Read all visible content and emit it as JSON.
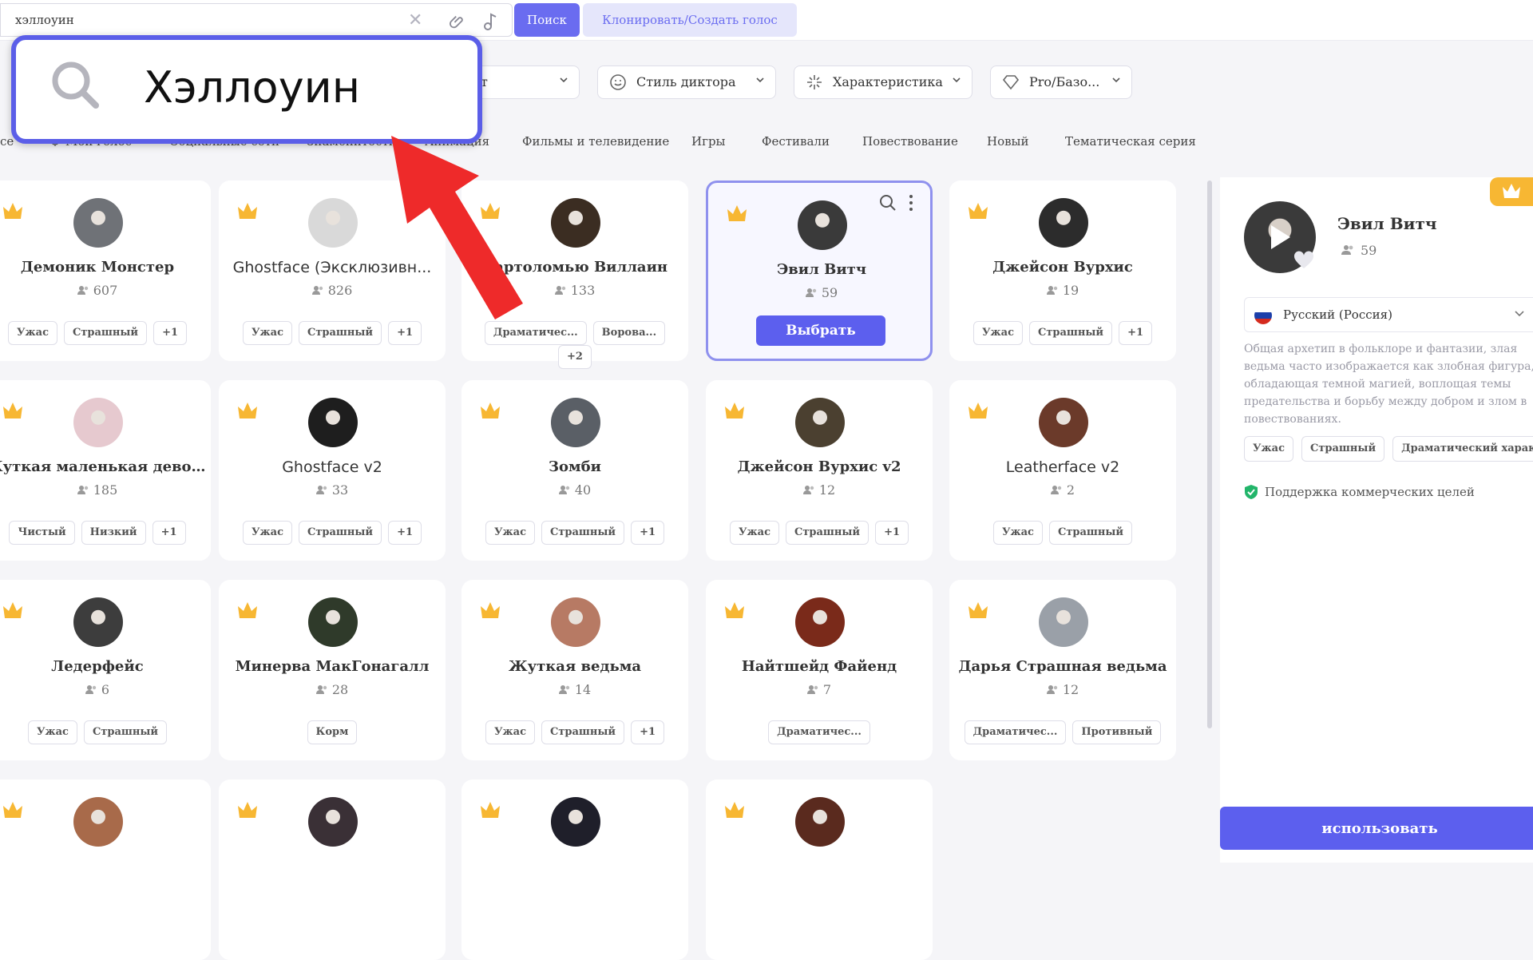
{
  "topbar": {
    "search_value": "хэллоуин",
    "search_button": "Поиск",
    "clone_button": "Клонировать/Создать голос"
  },
  "zoom_overlay": {
    "text": "Хэллоуин"
  },
  "filters": [
    {
      "label": "ст"
    },
    {
      "label": "Стиль диктора"
    },
    {
      "label": "Характеристика"
    },
    {
      "label": "Pro/Базо..."
    }
  ],
  "tabs": [
    {
      "label": "се"
    },
    {
      "label": "Мой голос"
    },
    {
      "label": "Социальные сети"
    },
    {
      "label": "Знаменитости"
    },
    {
      "label": "Анимация"
    },
    {
      "label": "Фильмы и телевидение"
    },
    {
      "label": "Игры"
    },
    {
      "label": "Фестивали"
    },
    {
      "label": "Повествование"
    },
    {
      "label": "Новый"
    },
    {
      "label": "Тематическая серия"
    }
  ],
  "cards": [
    {
      "name": "Демоник Монстер",
      "count": "607",
      "tags": [
        "Ужас",
        "Страшный",
        "+1"
      ],
      "avatar_color": "#6f7277"
    },
    {
      "name": "Ghostface (Эксклюзивн...",
      "count": "826",
      "tags": [
        "Ужас",
        "Страшный",
        "+1"
      ],
      "avatar_color": "#d9d9d9"
    },
    {
      "name": "Бартоломью Виллаин",
      "count": "133",
      "tags": [
        "Драматичес...",
        "Ворова...",
        "+2"
      ],
      "avatar_color": "#3b2d22"
    },
    {
      "name": "Эвил Витч",
      "count": "59",
      "tags": [],
      "select_label": "Выбрать",
      "avatar_color": "#3a3a3a"
    },
    {
      "name": "Джейсон Вурхис",
      "count": "19",
      "tags": [
        "Ужас",
        "Страшный",
        "+1"
      ],
      "avatar_color": "#2c2c2c"
    },
    {
      "name": "Жуткая маленькая девочка",
      "count": "185",
      "tags": [
        "Чистый",
        "Низкий",
        "+1"
      ],
      "avatar_color": "#e6c9cf"
    },
    {
      "name": "Ghostface v2",
      "count": "33",
      "tags": [
        "Ужас",
        "Страшный",
        "+1"
      ],
      "avatar_color": "#1e1e1e"
    },
    {
      "name": "Зомби",
      "count": "40",
      "tags": [
        "Ужас",
        "Страшный",
        "+1"
      ],
      "avatar_color": "#5a5f66"
    },
    {
      "name": "Джейсон Вурхис v2",
      "count": "12",
      "tags": [
        "Ужас",
        "Страшный",
        "+1"
      ],
      "avatar_color": "#4b4030"
    },
    {
      "name": "Leatherface v2",
      "count": "2",
      "tags": [
        "Ужас",
        "Страшный"
      ],
      "avatar_color": "#6b3a2a"
    },
    {
      "name": "Ледерфейс",
      "count": "6",
      "tags": [
        "Ужас",
        "Страшный"
      ],
      "avatar_color": "#3d3d3d"
    },
    {
      "name": "Минерва МакГонагалл",
      "count": "28",
      "tags": [
        "Корм"
      ],
      "avatar_color": "#2f3a2a"
    },
    {
      "name": "Жуткая ведьма",
      "count": "14",
      "tags": [
        "Ужас",
        "Страшный",
        "+1"
      ],
      "avatar_color": "#b77a64"
    },
    {
      "name": "Найтшейд Файенд",
      "count": "7",
      "tags": [
        "Драматичес..."
      ],
      "avatar_color": "#7a2a1a"
    },
    {
      "name": "Дарья Страшная ведьма",
      "count": "12",
      "tags": [
        "Драматичес...",
        "Противный"
      ],
      "avatar_color": "#9aa0a8"
    },
    {
      "avatar_color": "#a86a4a"
    },
    {
      "avatar_color": "#3a3036"
    },
    {
      "avatar_color": "#1f1f2a"
    },
    {
      "avatar_color": "#5a2a1e"
    }
  ],
  "panel": {
    "name": "Эвил Витч",
    "count": "59",
    "language": "Русский (Россия)",
    "description": "Общая архетип в фольклоре и фантазии, злая ведьма часто изображается как злобная фигура, обладающая темной магией, воплощая темы предательства и борьбу между добром и злом в повествованиях.",
    "tags": [
      "Ужас",
      "Страшный",
      "Драматический характер"
    ],
    "support": "Поддержка коммерческих целей",
    "use_button": "использовать"
  },
  "colors": {
    "accent": "#5c5fee",
    "crown": "#f7b733"
  }
}
